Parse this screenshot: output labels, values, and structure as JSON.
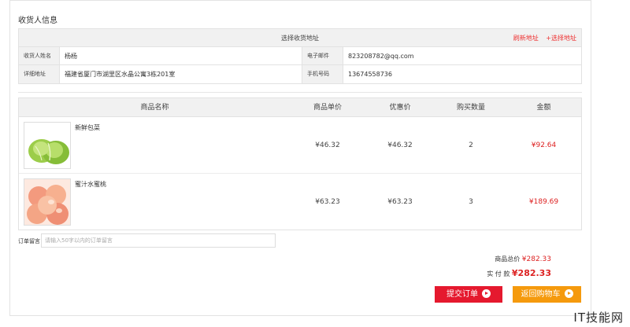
{
  "section_title": "收货人信息",
  "address": {
    "header": "选择收货地址",
    "link_refresh": "刷新地址",
    "link_select": "+选择地址",
    "rows": [
      {
        "label1": "收货人姓名",
        "value1": "杨杨",
        "label2": "电子邮件",
        "value2": "823208782@qq.com"
      },
      {
        "label1": "详细地址",
        "value1": "福建省厦门市湖里区水晶公寓3栋201室",
        "label2": "手机号码",
        "value2": "13674558736"
      }
    ]
  },
  "goods": {
    "headers": {
      "name": "商品名称",
      "price": "商品单价",
      "discount": "优惠价",
      "qty": "购买数量",
      "amount": "金额"
    },
    "items": [
      {
        "name": "新鲜包菜",
        "price": "¥46.32",
        "discount": "¥46.32",
        "qty": "2",
        "amount": "¥92.64",
        "image": "cabbage-image"
      },
      {
        "name": "蜜汁水蜜桃",
        "price": "¥63.23",
        "discount": "¥63.23",
        "qty": "3",
        "amount": "¥189.69",
        "image": "peach-image"
      }
    ]
  },
  "remark": {
    "label": "订单留言",
    "placeholder": "请输入50字以内的订单留言"
  },
  "totals": {
    "goods_total_label": "商品总价",
    "goods_total": "¥282.33",
    "paid_label": "实 付 款",
    "paid": "¥282.33"
  },
  "buttons": {
    "submit": "提交订单",
    "back": "返回购物车"
  },
  "watermark": "IT技能网",
  "colors": {
    "accent_red": "#e5192e",
    "accent_orange": "#f59a0d",
    "price_red": "#d22"
  }
}
